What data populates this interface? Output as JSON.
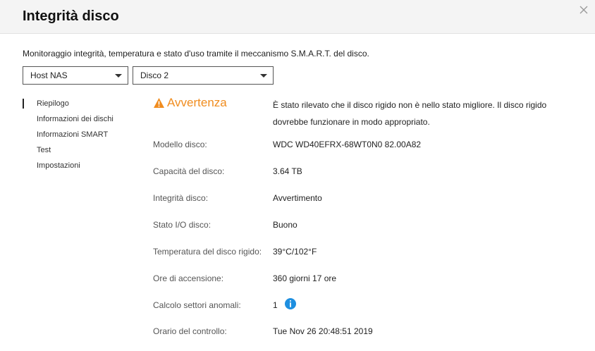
{
  "dialog": {
    "title": "Integrità disco",
    "description": "Monitoraggio integrità, temperatura e stato d'uso tramite il meccanismo S.M.A.R.T. del disco."
  },
  "selectors": {
    "host": "Host NAS",
    "disk": "Disco 2"
  },
  "nav": {
    "items": [
      {
        "label": "Riepilogo",
        "active": true
      },
      {
        "label": "Informazioni dei dischi",
        "active": false
      },
      {
        "label": "Informazioni SMART",
        "active": false
      },
      {
        "label": "Test",
        "active": false
      },
      {
        "label": "Impostazioni",
        "active": false
      }
    ]
  },
  "summary": {
    "status_label": "Avvertenza",
    "status_message": "È stato rilevato che il disco rigido non è nello stato migliore. Il disco rigido dovrebbe funzionare in modo appropriato.",
    "rows": [
      {
        "label": "Modello disco:",
        "value": "WDC WD40EFRX-68WT0N0 82.00A82"
      },
      {
        "label": "Capacità del disco:",
        "value": "3.64 TB"
      },
      {
        "label": "Integrità disco:",
        "value": "Avvertimento"
      },
      {
        "label": "Stato I/O disco:",
        "value": "Buono"
      },
      {
        "label": "Temperatura del disco rigido:",
        "value": "39°C/102°F"
      },
      {
        "label": "Ore di accensione:",
        "value": "360 giorni 17 ore"
      },
      {
        "label": "Calcolo settori anomali:",
        "value": "1"
      },
      {
        "label": "Orario del controllo:",
        "value": "Tue Nov 26 20:48:51 2019"
      }
    ]
  },
  "colors": {
    "warning": "#f08c1e",
    "info": "#1e8fe0"
  },
  "icons": {
    "close": "close-icon",
    "warning": "warning-icon",
    "info": "info-icon"
  }
}
